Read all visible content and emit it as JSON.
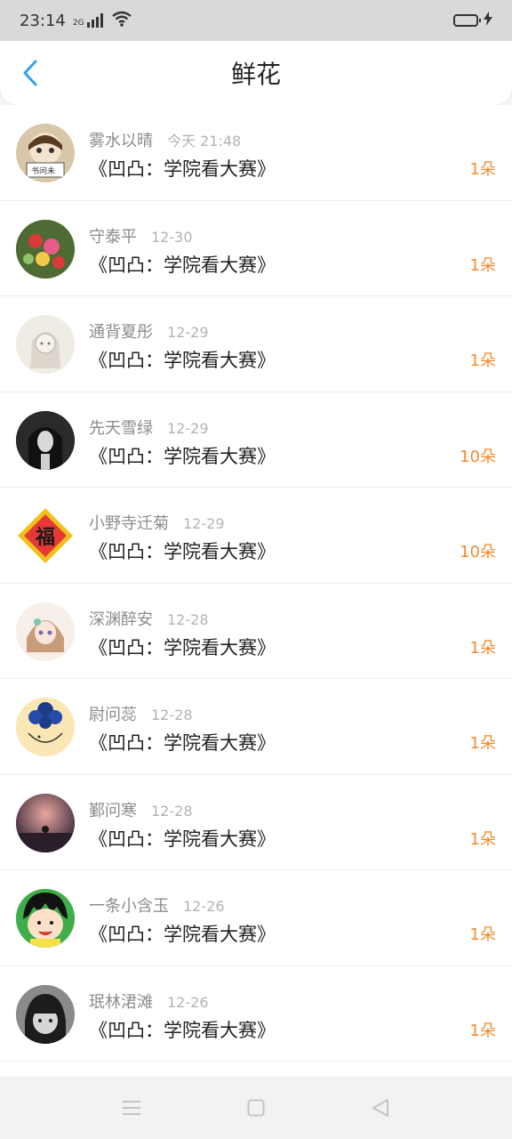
{
  "status": {
    "time": "23:14",
    "network": "2G",
    "icons": [
      "signal-icon",
      "wifi-icon",
      "battery-icon",
      "charging-icon"
    ]
  },
  "header": {
    "title": "鲜花",
    "back_icon": "back-arrow-icon"
  },
  "colors": {
    "accent": "#2ea3f2",
    "count": "#f28a2e"
  },
  "items": [
    {
      "name": "雾水以晴",
      "date": "今天 21:48",
      "book": "《凹凸：学院看大赛》",
      "count": "1朵"
    },
    {
      "name": "守泰平",
      "date": "12-30",
      "book": "《凹凸：学院看大赛》",
      "count": "1朵"
    },
    {
      "name": "通背夏彤",
      "date": "12-29",
      "book": "《凹凸：学院看大赛》",
      "count": "1朵"
    },
    {
      "name": "先天雪绿",
      "date": "12-29",
      "book": "《凹凸：学院看大赛》",
      "count": "10朵"
    },
    {
      "name": "小野寺迁菊",
      "date": "12-29",
      "book": "《凹凸：学院看大赛》",
      "count": "10朵"
    },
    {
      "name": "深渊醉安",
      "date": "12-28",
      "book": "《凹凸：学院看大赛》",
      "count": "1朵"
    },
    {
      "name": "尉问蕊",
      "date": "12-28",
      "book": "《凹凸：学院看大赛》",
      "count": "1朵"
    },
    {
      "name": "鄞问寒",
      "date": "12-28",
      "book": "《凹凸：学院看大赛》",
      "count": "1朵"
    },
    {
      "name": "一条小含玉",
      "date": "12-26",
      "book": "《凹凸：学院看大赛》",
      "count": "1朵"
    },
    {
      "name": "珉林涒滩",
      "date": "12-26",
      "book": "《凹凸：学院看大赛》",
      "count": "1朵"
    }
  ],
  "avatar_glyphs": {
    "fu": "福"
  },
  "navbar": {
    "icons": [
      "menu-icon",
      "home-square-icon",
      "back-triangle-icon"
    ]
  }
}
